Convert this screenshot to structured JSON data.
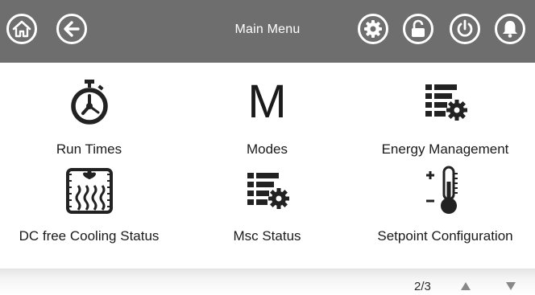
{
  "header": {
    "title": "Main Menu",
    "left_icons": [
      "home-icon",
      "back-icon"
    ],
    "right_icons": [
      "settings-icon",
      "lock-icon",
      "power-icon",
      "alarm-bell-icon"
    ],
    "background": "#6e6e6e"
  },
  "menu": {
    "items": [
      {
        "label": "Run Times",
        "icon": "stopwatch-icon"
      },
      {
        "label": "Modes",
        "icon": "modes-m-icon",
        "glyph": "M"
      },
      {
        "label": "Energy Management",
        "icon": "list-settings-icon"
      },
      {
        "label": "DC free Cooling Status",
        "icon": "free-cooling-icon"
      },
      {
        "label": "Msc Status",
        "icon": "list-settings-icon"
      },
      {
        "label": "Setpoint Configuration",
        "icon": "thermometer-setpoint-icon"
      }
    ]
  },
  "pager": {
    "page": "2/3",
    "up_icon": "page-up-icon",
    "down_icon": "page-down-icon"
  }
}
